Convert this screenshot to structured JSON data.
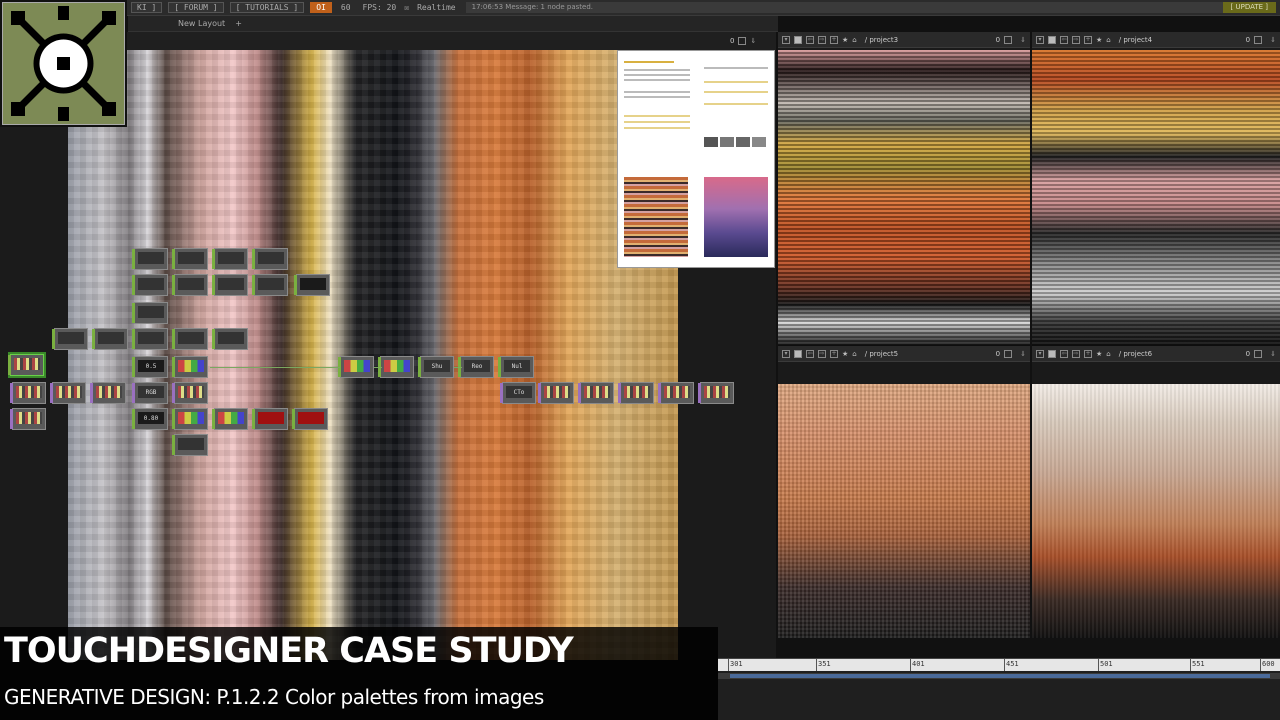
{
  "menubar": {
    "items": [
      "KI ]",
      "[ FORUM ]",
      "[ TUTORIALS ]",
      "OI",
      "60",
      "FPS:  20",
      "Realtime"
    ],
    "message": "17:06:53 Message: 1 node pasted.",
    "update": "[ UPDATE ]"
  },
  "layoutbar": {
    "tab": "New Layout",
    "plus": "+"
  },
  "nodes": {
    "val_a": "0.5",
    "val_b": "0.80",
    "shu": "Shu",
    "reo": "Reo",
    "nul": "Nul",
    "cto": "CTo",
    "rgb": "RGB"
  },
  "panes": {
    "p3": {
      "name": "/ project3",
      "zero": "0"
    },
    "p4": {
      "name": "/ project4",
      "zero": "0"
    },
    "p5": {
      "name": "/ project5",
      "zero": "0"
    },
    "p6": {
      "name": "/ project6",
      "zero": "0"
    }
  },
  "top_zero": "0",
  "timeline": {
    "ticks": [
      "301",
      "351",
      "401",
      "451",
      "501",
      "551",
      "600"
    ]
  },
  "overlay": {
    "title": "TOUCHDESIGNER CASE STUDY",
    "subtitle": "GENERATIVE DESIGN: P.1.2.2 Color palettes from images"
  },
  "colors": {
    "logo_bg": "#7d8a55",
    "accent_orange": "#c0601a",
    "node_green": "#7ab040",
    "node_purple": "#9a70c0"
  }
}
